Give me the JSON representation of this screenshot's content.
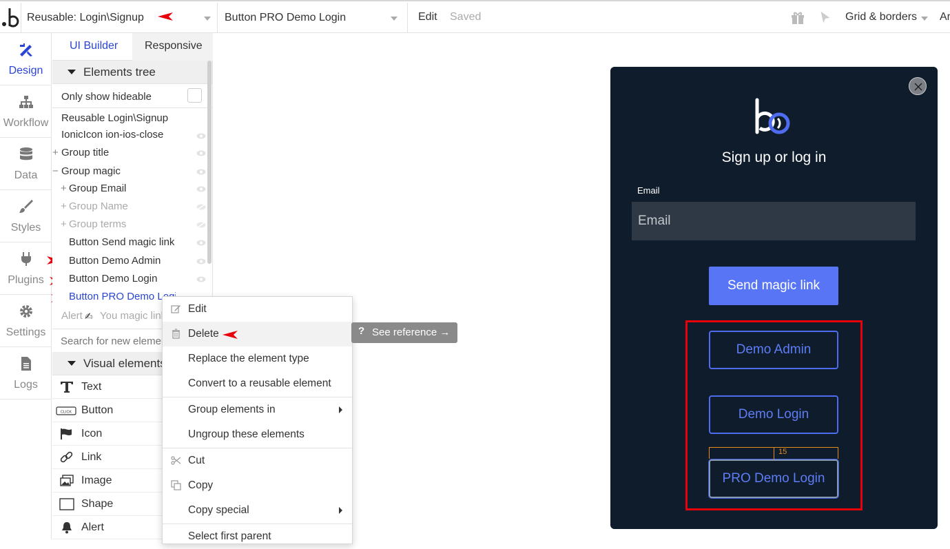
{
  "topbar": {
    "page_selector": "Reusable: Login\\Signup",
    "element_selector": "Button PRO Demo Login",
    "edit_label": "Edit",
    "saved_label": "Saved",
    "grid_label": "Grid & borders",
    "overflow_text": "Ar"
  },
  "nav": {
    "items": [
      {
        "label": "Design",
        "icon": "design-icon"
      },
      {
        "label": "Workflow",
        "icon": "workflow-icon"
      },
      {
        "label": "Data",
        "icon": "database-icon"
      },
      {
        "label": "Styles",
        "icon": "brush-icon"
      },
      {
        "label": "Plugins",
        "icon": "plug-icon"
      },
      {
        "label": "Settings",
        "icon": "gear-icon"
      },
      {
        "label": "Logs",
        "icon": "document-icon"
      }
    ]
  },
  "panel": {
    "tab_ui_builder": "UI Builder",
    "tab_responsive": "Responsive",
    "elements_tree_header": "Elements tree",
    "only_show_hideable": "Only show hideable",
    "tree": [
      "Reusable Login\\Signup",
      "IonicIcon ion-ios-close",
      "Group title",
      "Group magic",
      "Group Email",
      "Group Name",
      "Group terms",
      "Button Send magic link",
      "Button Demo Admin",
      "Button Demo Login",
      "Button PRO Demo Login",
      "Alert",
      "You magic link"
    ],
    "tree_prefix_plus": "+",
    "tree_prefix_minus": "−",
    "search_placeholder": "Search for new elements...",
    "visual_elements_header": "Visual elements",
    "visual_elements": [
      {
        "label": "Text",
        "icon": "text-icon"
      },
      {
        "label": "Button",
        "icon": "button-icon"
      },
      {
        "label": "Icon",
        "icon": "flag-icon"
      },
      {
        "label": "Link",
        "icon": "link-icon"
      },
      {
        "label": "Image",
        "icon": "image-icon"
      },
      {
        "label": "Shape",
        "icon": "shape-icon"
      },
      {
        "label": "Alert",
        "icon": "bell-icon"
      }
    ]
  },
  "context_menu": {
    "items": [
      "Edit",
      "Delete",
      "Replace the element type",
      "Convert to a reusable element",
      "Group elements in",
      "Ungroup these elements",
      "Cut",
      "Copy",
      "Copy special",
      "Select first parent"
    ]
  },
  "tooltip": {
    "icon": "?",
    "label": "See reference →"
  },
  "popup": {
    "title": "Sign up or log in",
    "email_label": "Email",
    "email_placeholder": "Email",
    "send_button": "Send magic link",
    "demo_admin_button": "Demo Admin",
    "demo_login_button": "Demo Login",
    "pro_demo_login_button": "PRO Demo Login",
    "spacing_readout": "15"
  },
  "colors": {
    "accent": "#2a45d4",
    "popup_bg": "#0f1c2b",
    "primary_button": "#5875f5",
    "outline_button": "#4e6cf0",
    "annotation_red": "#e8000b",
    "guide_orange": "#e98b1c"
  }
}
